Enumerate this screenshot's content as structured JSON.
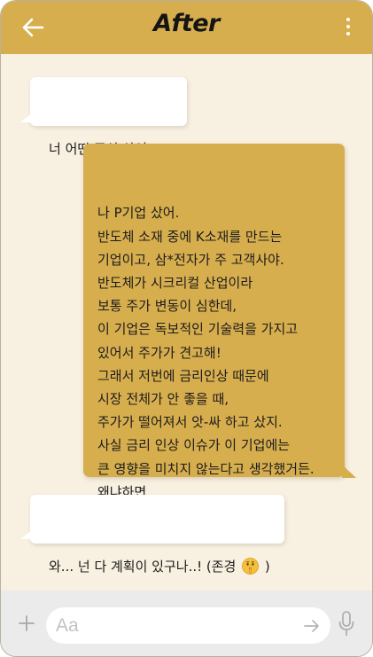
{
  "header": {
    "title": "After",
    "back_icon": "arrow-left-icon",
    "menu_icon": "more-vertical-icon"
  },
  "messages": [
    {
      "side": "left",
      "text": "너 어떤 주식 샀어?"
    },
    {
      "side": "right",
      "text": "나 P기업 샀어.\n반도체 소재 중에 K소재를 만드는\n기업이고, 삼*전자가 주 고객사야.\n반도체가 시크리컬 산업이라\n보통 주가 변동이 심한데,\n이 기업은 독보적인 기술력을 가지고\n있어서 주가가 견고해!\n그래서 저번에 금리인상 때문에\n시장 전체가 안 좋을 때,\n주가가 떨어져서 앗-싸 하고 샀지.\n사실 금리 인상 이슈가 이 기업에는\n큰 영향을 미치지 않는다고 생각했거든.\n왜냐하면...."
    },
    {
      "side": "left",
      "text_before": "와... 넌 다 계획이 있구나..! (존경 ",
      "emoji": "shushing-face-emoji",
      "text_after": " )"
    }
  ],
  "input": {
    "placeholder": "Aa",
    "plus_icon": "plus-icon",
    "send_icon": "arrow-right-icon",
    "mic_icon": "microphone-icon"
  },
  "colors": {
    "header_bg": "#d7ae4e",
    "chat_bg": "#f8f0e0",
    "sent_bubble": "#d7ae4e",
    "received_bubble": "#ffffff",
    "input_bar_bg": "#ebebeb"
  }
}
